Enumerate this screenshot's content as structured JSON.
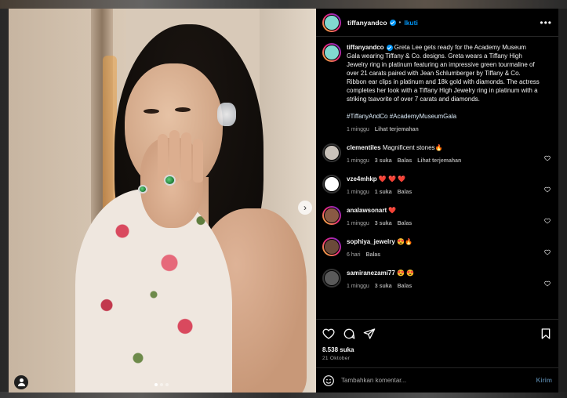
{
  "post": {
    "username": "tiffanyandco",
    "follow_label": "Ikuti",
    "separator": "•",
    "more_glyph": "•••",
    "avatar_text": "TIFFANY & CO.",
    "caption": "Greta Lee gets ready for the Academy Museum Gala wearing Tiffany & Co. designs. Greta wears a Tiffany High Jewelry ring in platinum featuring an impressive green tourmaline of over 21 carats paired with Jean Schlumberger by Tiffany & Co. Ribbon ear clips in platinum and 18k gold with diamonds. The actress completes her look with a Tiffany High Jewelry ring in platinum with a striking tsavorite of over 7 carats and diamonds.",
    "hashtags": "#TiffanyAndCo #AcademyMuseumGala",
    "caption_time": "1 minggu",
    "translate_label": "Lihat terjemahan",
    "likes": "8.538 suka",
    "date": "21 Oktober",
    "carousel_dots": 3,
    "carousel_active": 1
  },
  "comments": [
    {
      "username": "clementiles",
      "text": "Magnificent stones🔥",
      "time": "1 minggu",
      "likes": "3 suka",
      "reply": "Balas",
      "translate": "Lihat terjemahan",
      "avatar_color": "#c9c2ba"
    },
    {
      "username": "vze4mhkp",
      "text": "❤️ ❤️ ❤️",
      "time": "1 minggu",
      "likes": "1 suka",
      "reply": "Balas",
      "translate": "",
      "avatar_color": "#ffffff"
    },
    {
      "username": "analawsonart",
      "text": "❤️",
      "time": "1 minggu",
      "likes": "3 suka",
      "reply": "Balas",
      "translate": "",
      "avatar_color": "#8a5a44"
    },
    {
      "username": "sophiya_jewelry",
      "text": "😍🔥",
      "time": "6 hari",
      "likes": "",
      "reply": "Balas",
      "translate": "",
      "avatar_color": "#6b4a3a"
    },
    {
      "username": "samiranezami77",
      "text": "😍 😍",
      "time": "1 minggu",
      "likes": "3 suka",
      "reply": "Balas",
      "translate": "",
      "avatar_color": "#5a5a5a"
    }
  ],
  "composer": {
    "placeholder": "Tambahkan komentar...",
    "post_label": "Kirim"
  },
  "colors": {
    "accent": "#0095f6",
    "background": "#000000",
    "text": "#f5f5f5",
    "muted": "#a8a8a8",
    "tiffany_blue": "#81d8d0"
  },
  "icons": [
    "heart-icon",
    "comment-icon",
    "share-icon",
    "bookmark-icon",
    "emoji-icon",
    "next-icon",
    "user-tag-icon",
    "verified-icon"
  ]
}
